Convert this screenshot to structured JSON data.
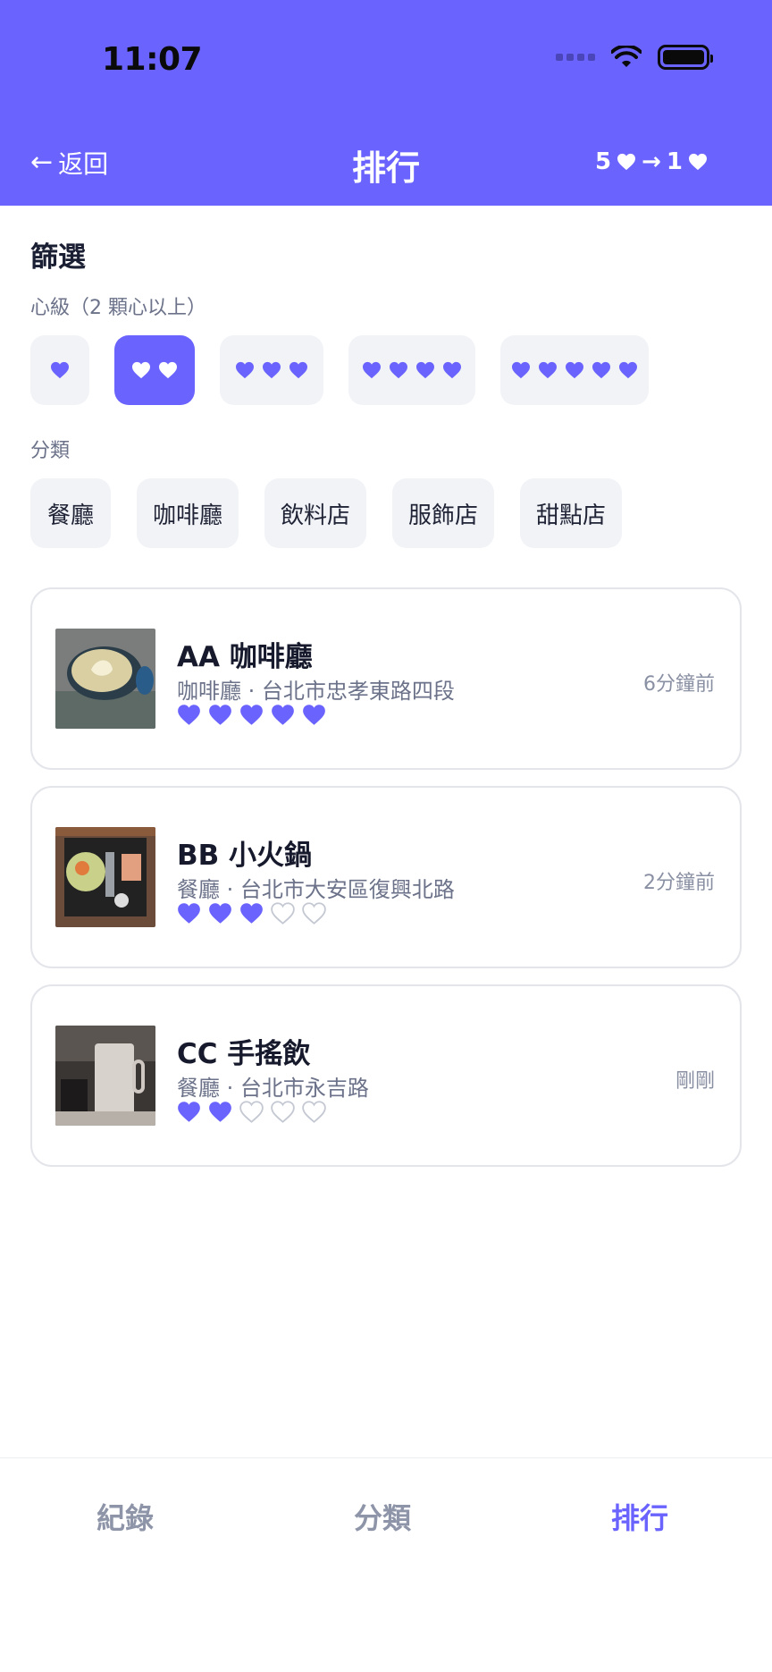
{
  "status_bar": {
    "time": "11:07"
  },
  "header": {
    "back_label": "返回",
    "title": "排行",
    "sort_from": "5",
    "sort_to": "1"
  },
  "filters": {
    "section_title": "篩選",
    "level_label": "心級（2 顆心以上）",
    "levels": [
      1,
      2,
      3,
      4,
      5
    ],
    "selected_level": 2,
    "category_label": "分類",
    "categories": [
      "餐廳",
      "咖啡廳",
      "飲料店",
      "服飾店",
      "甜點店"
    ]
  },
  "records": [
    {
      "name": "AA 咖啡廳",
      "meta": "咖啡廳 · 台北市忠孝東路四段",
      "hearts": 5,
      "time": "6分鐘前",
      "photo": "latte-photo"
    },
    {
      "name": "BB 小火鍋",
      "meta": "餐廳 · 台北市大安區復興北路",
      "hearts": 3,
      "time": "2分鐘前",
      "photo": "hotpot-photo"
    },
    {
      "name": "CC 手搖飲",
      "meta": "餐廳 · 台北市永吉路",
      "hearts": 2,
      "time": "剛剛",
      "photo": "drink-photo"
    }
  ],
  "bottom_nav": {
    "items": [
      "紀錄",
      "分類",
      "排行"
    ],
    "active": "排行"
  },
  "colors": {
    "accent": "#6a63fd",
    "chip_bg": "#f1f3f7",
    "muted_text": "#6b7289"
  }
}
